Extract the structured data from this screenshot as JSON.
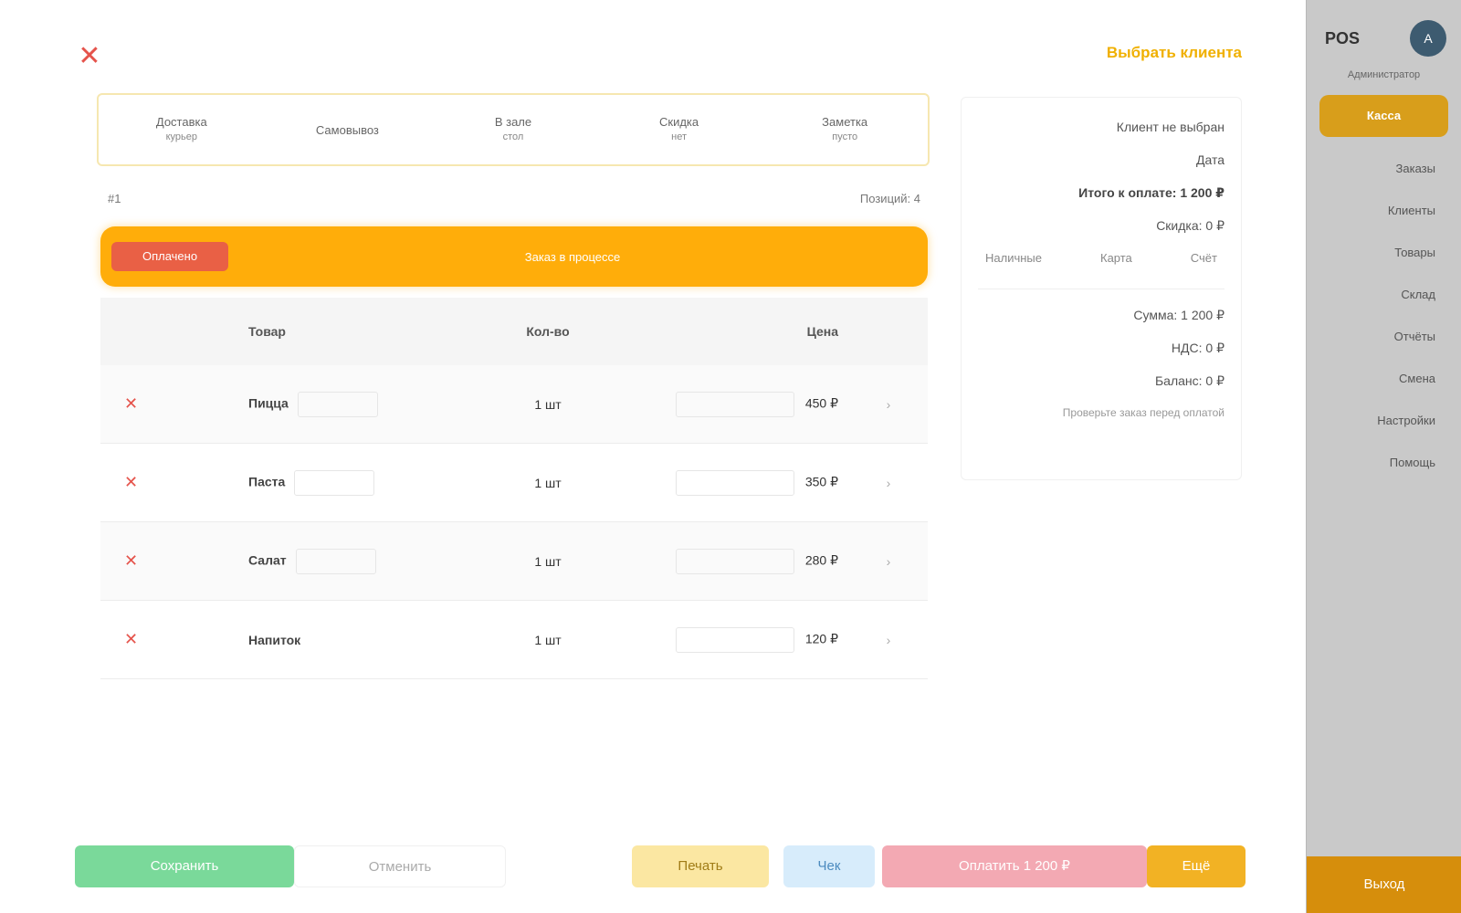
{
  "header": {
    "close_symbol": "✕",
    "status_link": "Выбрать клиента"
  },
  "filters": [
    {
      "label": "Доставка",
      "sub": "курьер"
    },
    {
      "label": "Самовывоз",
      "sub": ""
    },
    {
      "label": "В зале",
      "sub": "стол"
    },
    {
      "label": "Скидка",
      "sub": "нет"
    },
    {
      "label": "Заметка",
      "sub": "пусто"
    }
  ],
  "info_row": {
    "left": "#1",
    "right": "Позиций: 4"
  },
  "progress": {
    "done_label": "Оплачено",
    "center_label": "Заказ в процессе",
    "fraction": 0.14
  },
  "table": {
    "headers": [
      "",
      "Товар",
      "Кол-во",
      "Цена",
      ""
    ],
    "rows": [
      {
        "name": "Пицца",
        "qty": "1 шт",
        "price": "450 ₽"
      },
      {
        "name": "Паста",
        "qty": "1 шт",
        "price": "350 ₽"
      },
      {
        "name": "Салат",
        "qty": "1 шт",
        "price": "280 ₽"
      },
      {
        "name": "Напиток",
        "qty": "1 шт",
        "price": "120 ₽"
      }
    ],
    "delete_symbol": "✕",
    "chevron_symbol": "›"
  },
  "summary": {
    "client": "Клиент не выбран",
    "date": "Дата",
    "total_label": "Итого к оплате: 1 200 ₽",
    "discount": "Скидка: 0 ₽",
    "pay_methods": [
      "Наличные",
      "Карта",
      "Счёт"
    ],
    "subtotal": "Сумма: 1 200 ₽",
    "tax": "НДС: 0 ₽",
    "balance": "Баланс: 0 ₽",
    "note": "Проверьте заказ перед оплатой"
  },
  "bottom": {
    "green": "Сохранить",
    "ghost": "Отменить",
    "yellow": "Печать",
    "blue": "Чек",
    "pink": "Оплатить 1 200 ₽",
    "orange": "Ещё"
  },
  "sidebar": {
    "brand": "POS",
    "avatar_initials": "A",
    "user": "Администратор",
    "active_item": "Касса",
    "items": [
      "Заказы",
      "Клиенты",
      "Товары",
      "Склад",
      "Отчёты",
      "Смена",
      "Настройки",
      "Помощь"
    ],
    "bottom_label": "Выход"
  }
}
